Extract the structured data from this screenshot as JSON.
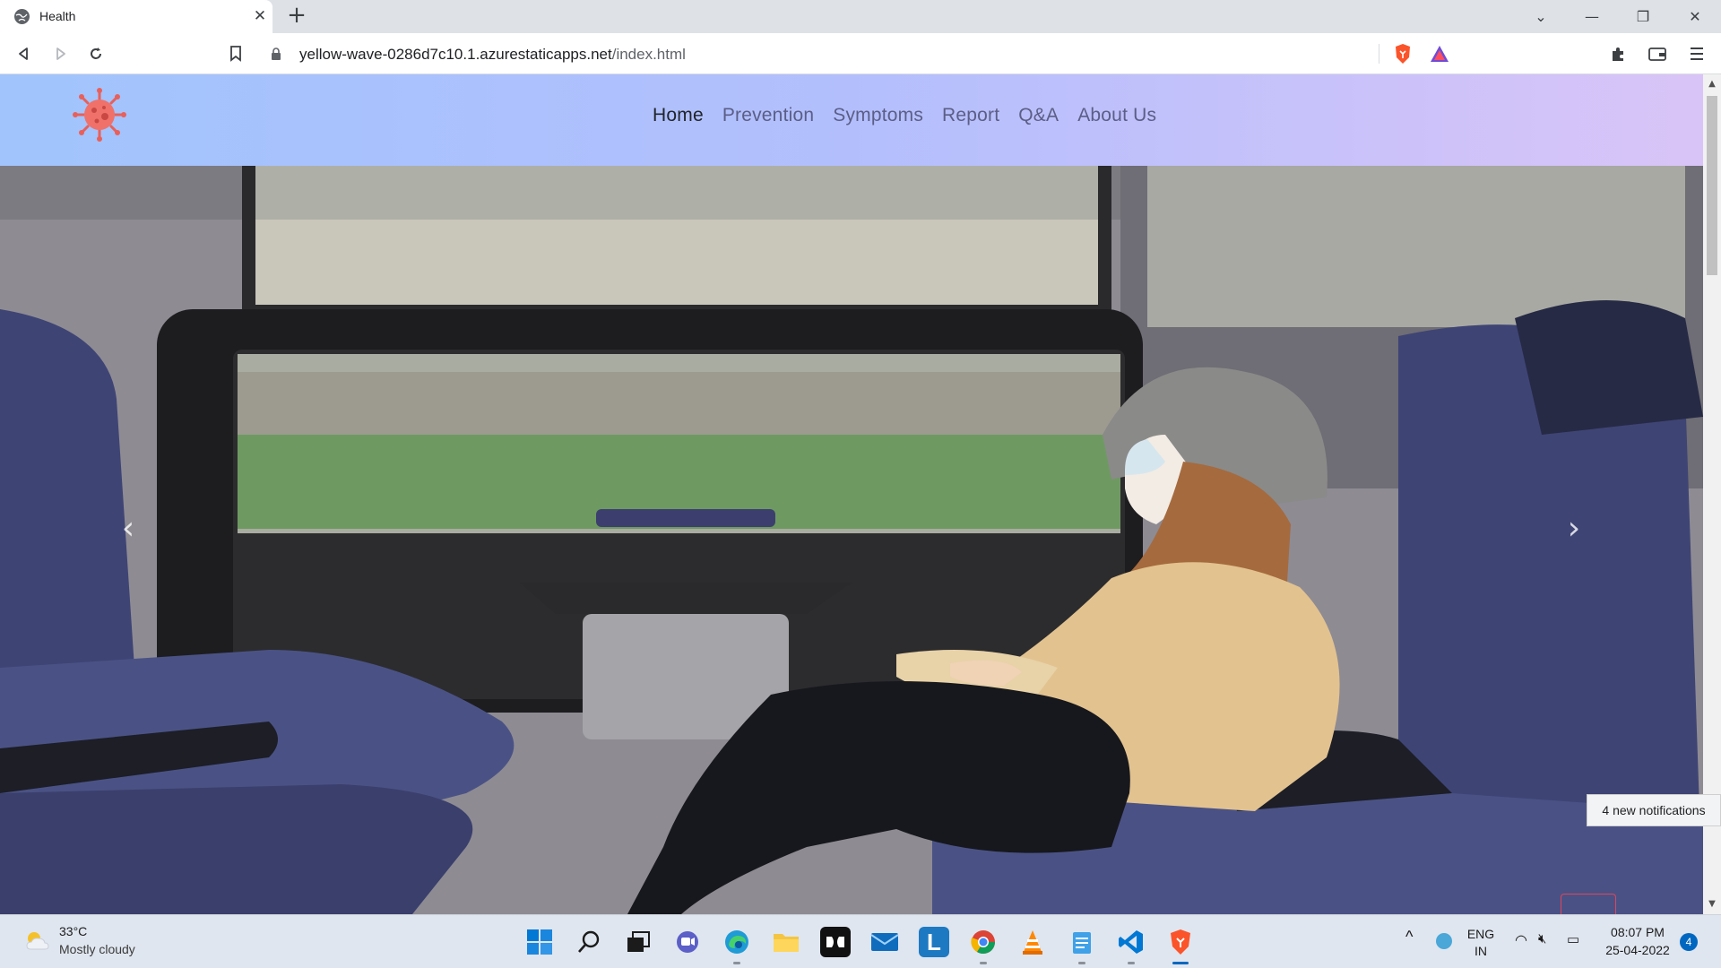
{
  "browser": {
    "tab_title": "Health",
    "url_host": "yellow-wave-0286d7c10.1.azurestaticapps.net",
    "url_path": "/index.html"
  },
  "site": {
    "nav": [
      {
        "label": "Home",
        "active": true
      },
      {
        "label": "Prevention"
      },
      {
        "label": "Symptoms"
      },
      {
        "label": "Report"
      },
      {
        "label": "Q&A"
      },
      {
        "label": "About Us"
      }
    ],
    "hero_image": "woman-in-face-mask-on-train",
    "carousel_prev_icon": "chevron-left-icon",
    "carousel_next_icon": "chevron-right-icon"
  },
  "notifications": {
    "toast": "4 new notifications",
    "count": "4"
  },
  "taskbar": {
    "weather_temp": "33°C",
    "weather_desc": "Mostly cloudy",
    "lang": "ENG",
    "region": "IN",
    "time": "08:07 PM",
    "date": "25-04-2022",
    "apps": [
      "windows-start",
      "search",
      "task-view",
      "teams-chat",
      "edge",
      "file-explorer",
      "dolby",
      "mail",
      "l-app",
      "chrome",
      "vlc",
      "notepad",
      "vscode",
      "brave"
    ]
  },
  "colors": {
    "header_gradient_start": "#a1c4fd",
    "header_gradient_end": "#d9c4f7",
    "nav_text": "#5b5e86",
    "nav_active": "#212529",
    "back_to_top_border": "#e0455a"
  }
}
